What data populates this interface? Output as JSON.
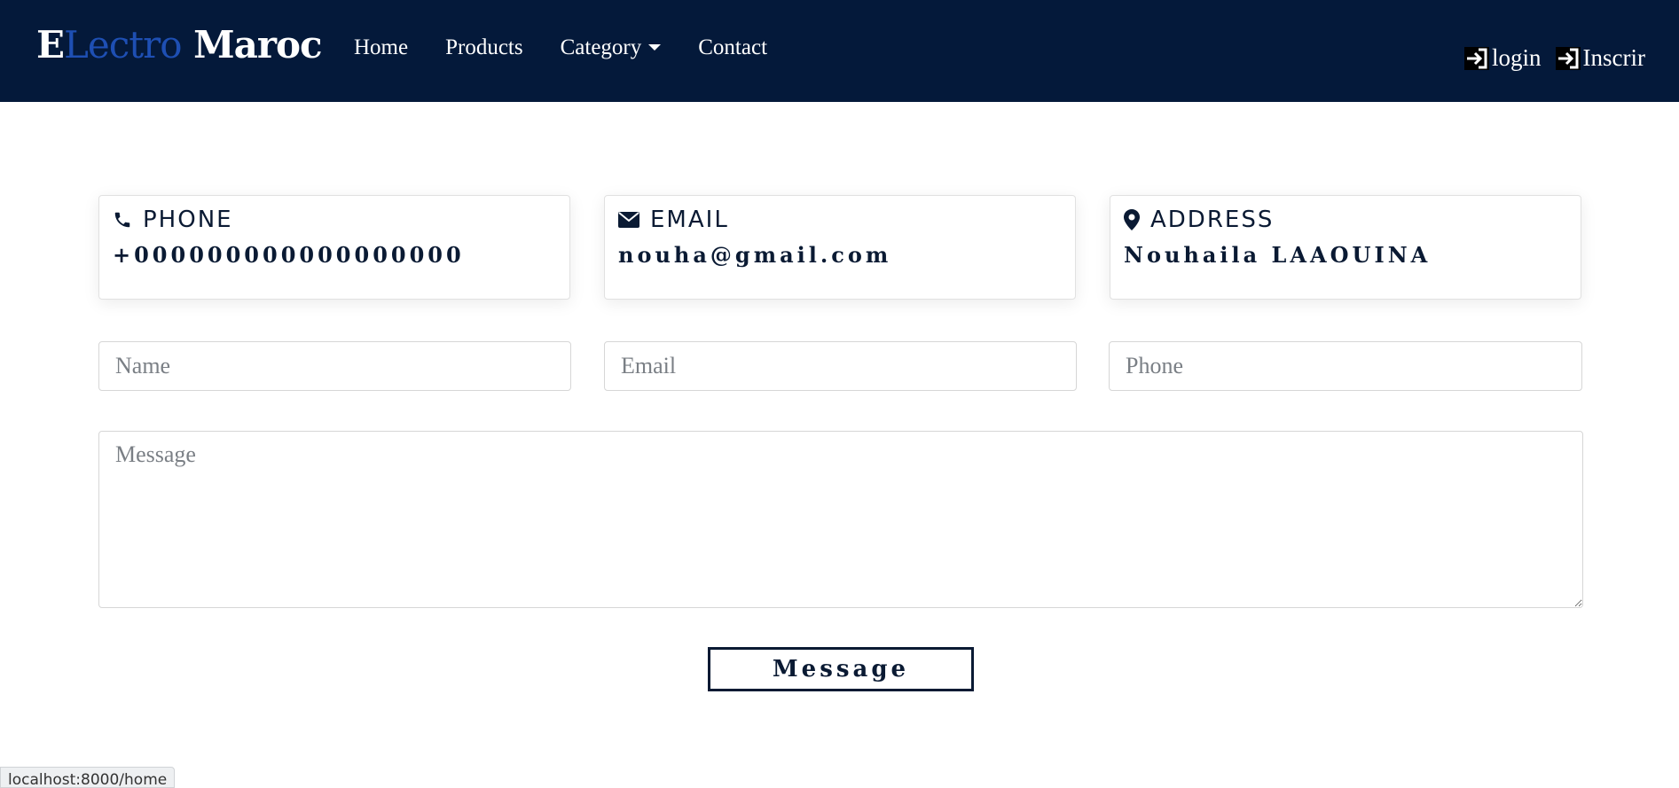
{
  "brand": {
    "part1": "E",
    "part2": "Lectro",
    "part3": " Maroc"
  },
  "nav": {
    "home": "Home",
    "products": "Products",
    "category": "Category",
    "contact": "Contact"
  },
  "auth": {
    "login": "login",
    "signup": "Inscrir"
  },
  "contact_cards": [
    {
      "label": "PHONE",
      "value": "+000000000000000000",
      "icon": "phone-icon"
    },
    {
      "label": "EMAIL",
      "value": "nouha@gmail.com",
      "icon": "envelope-icon"
    },
    {
      "label": "ADDRESS",
      "value": "Nouhaila LAAOUINA",
      "icon": "map-marker-icon"
    }
  ],
  "form": {
    "name_placeholder": "Name",
    "email_placeholder": "Email",
    "phone_placeholder": "Phone",
    "message_placeholder": "Message",
    "submit_label": "Message"
  },
  "status_bar": {
    "url": "localhost:8000/home"
  },
  "colors": {
    "navbar": "#04193a",
    "brand_accent": "#1e4fb3",
    "text_dark": "#0a1a33"
  }
}
